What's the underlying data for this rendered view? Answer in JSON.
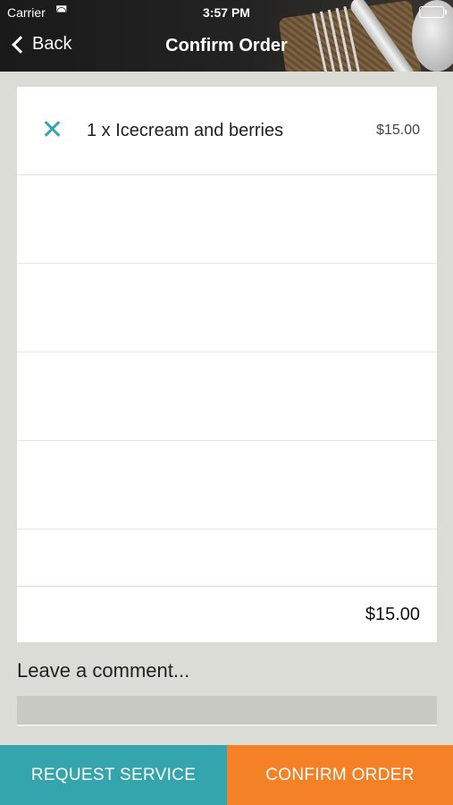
{
  "status_bar": {
    "carrier": "Carrier",
    "time": "3:57 PM"
  },
  "nav": {
    "back_label": "Back",
    "title": "Confirm Order"
  },
  "order": {
    "items": [
      {
        "name": "1 x Icecream and berries",
        "price": "$15.00"
      }
    ],
    "empty_rows": 5,
    "total": "$15.00"
  },
  "comment": {
    "label": "Leave a comment...",
    "value": ""
  },
  "actions": {
    "request_service": "REQUEST SERVICE",
    "confirm_order": "CONFIRM ORDER"
  },
  "colors": {
    "accent_teal": "#35a5ad",
    "accent_orange": "#f58127",
    "background": "#dcdcd6"
  }
}
